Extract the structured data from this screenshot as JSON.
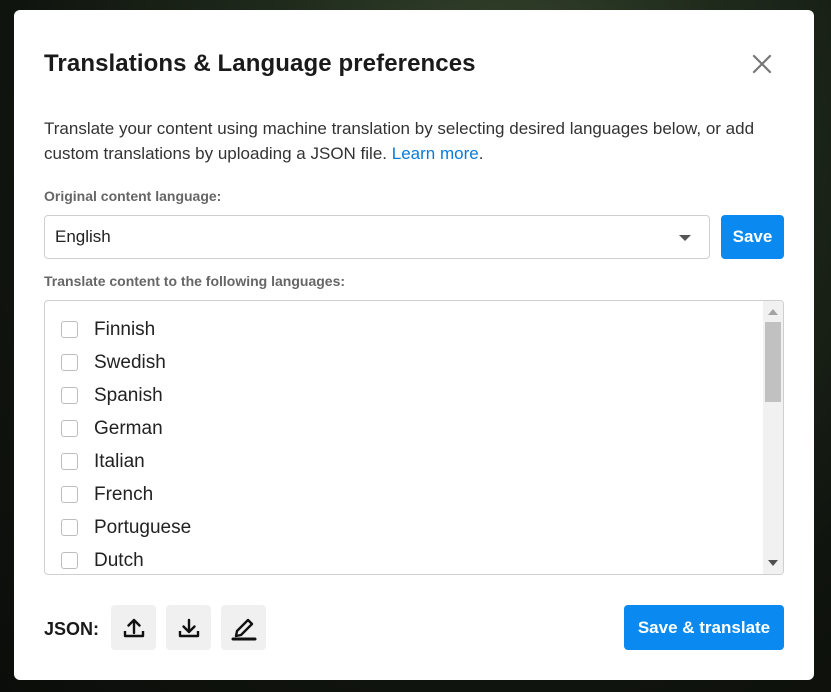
{
  "dialog": {
    "title": "Translations & Language preferences",
    "description_text": "Translate your content using machine translation by selecting desired languages below, or add custom translations by uploading a JSON file.",
    "learn_more_link": "Learn more",
    "description_end": "."
  },
  "original_language": {
    "label": "Original content language:",
    "selected": "English",
    "save_label": "Save"
  },
  "translate_to": {
    "label": "Translate content to the following languages:",
    "languages": [
      {
        "name": "Finnish",
        "checked": false
      },
      {
        "name": "Swedish",
        "checked": false
      },
      {
        "name": "Spanish",
        "checked": false
      },
      {
        "name": "German",
        "checked": false
      },
      {
        "name": "Italian",
        "checked": false
      },
      {
        "name": "French",
        "checked": false
      },
      {
        "name": "Portuguese",
        "checked": false
      },
      {
        "name": "Dutch",
        "checked": false
      }
    ]
  },
  "footer": {
    "json_label": "JSON:",
    "icons": [
      "upload-icon",
      "download-icon",
      "edit-icon"
    ],
    "save_translate_label": "Save & translate"
  },
  "colors": {
    "primary": "#0a8af0",
    "link": "#0a7bd8"
  }
}
